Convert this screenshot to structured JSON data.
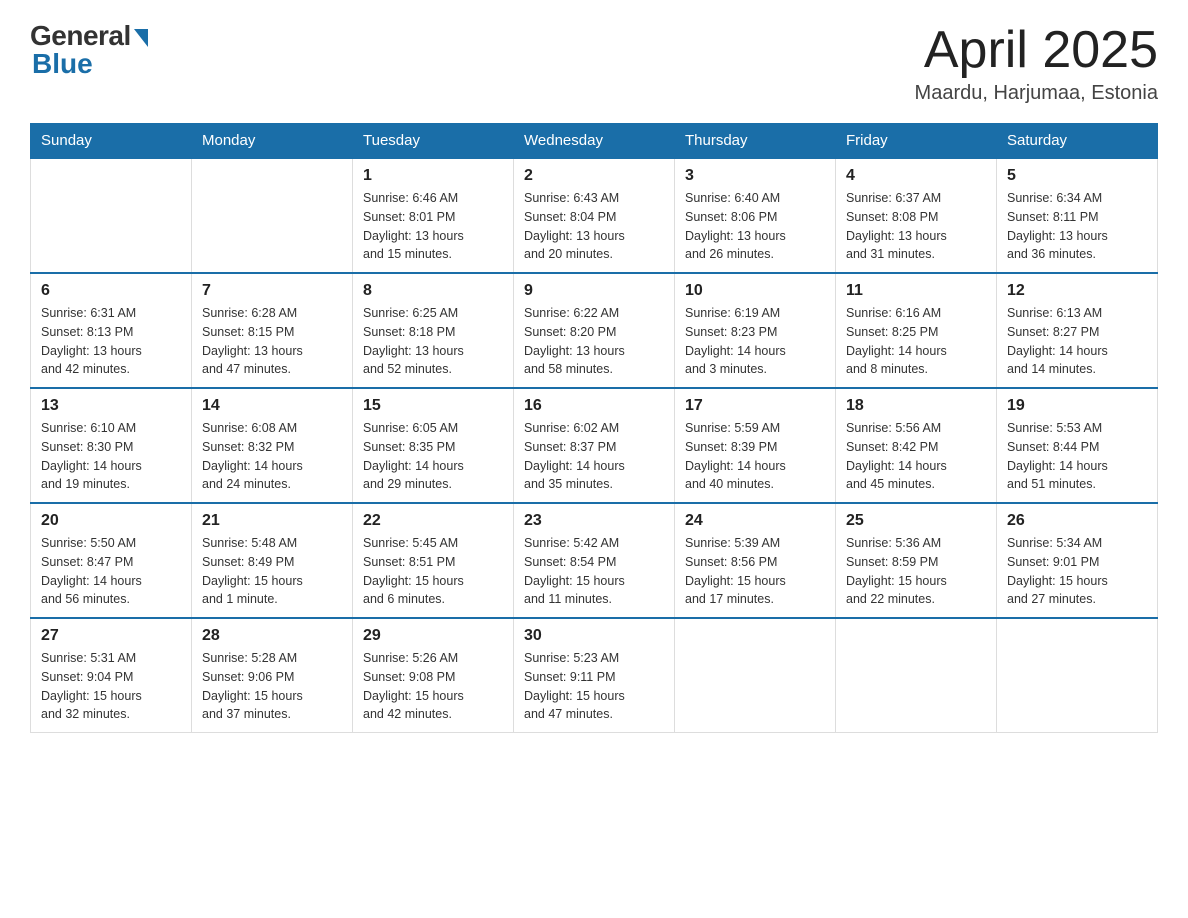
{
  "header": {
    "logo_general": "General",
    "logo_blue": "Blue",
    "month_title": "April 2025",
    "location": "Maardu, Harjumaa, Estonia"
  },
  "days_of_week": [
    "Sunday",
    "Monday",
    "Tuesday",
    "Wednesday",
    "Thursday",
    "Friday",
    "Saturday"
  ],
  "weeks": [
    [
      {
        "day": "",
        "info": ""
      },
      {
        "day": "",
        "info": ""
      },
      {
        "day": "1",
        "info": "Sunrise: 6:46 AM\nSunset: 8:01 PM\nDaylight: 13 hours\nand 15 minutes."
      },
      {
        "day": "2",
        "info": "Sunrise: 6:43 AM\nSunset: 8:04 PM\nDaylight: 13 hours\nand 20 minutes."
      },
      {
        "day": "3",
        "info": "Sunrise: 6:40 AM\nSunset: 8:06 PM\nDaylight: 13 hours\nand 26 minutes."
      },
      {
        "day": "4",
        "info": "Sunrise: 6:37 AM\nSunset: 8:08 PM\nDaylight: 13 hours\nand 31 minutes."
      },
      {
        "day": "5",
        "info": "Sunrise: 6:34 AM\nSunset: 8:11 PM\nDaylight: 13 hours\nand 36 minutes."
      }
    ],
    [
      {
        "day": "6",
        "info": "Sunrise: 6:31 AM\nSunset: 8:13 PM\nDaylight: 13 hours\nand 42 minutes."
      },
      {
        "day": "7",
        "info": "Sunrise: 6:28 AM\nSunset: 8:15 PM\nDaylight: 13 hours\nand 47 minutes."
      },
      {
        "day": "8",
        "info": "Sunrise: 6:25 AM\nSunset: 8:18 PM\nDaylight: 13 hours\nand 52 minutes."
      },
      {
        "day": "9",
        "info": "Sunrise: 6:22 AM\nSunset: 8:20 PM\nDaylight: 13 hours\nand 58 minutes."
      },
      {
        "day": "10",
        "info": "Sunrise: 6:19 AM\nSunset: 8:23 PM\nDaylight: 14 hours\nand 3 minutes."
      },
      {
        "day": "11",
        "info": "Sunrise: 6:16 AM\nSunset: 8:25 PM\nDaylight: 14 hours\nand 8 minutes."
      },
      {
        "day": "12",
        "info": "Sunrise: 6:13 AM\nSunset: 8:27 PM\nDaylight: 14 hours\nand 14 minutes."
      }
    ],
    [
      {
        "day": "13",
        "info": "Sunrise: 6:10 AM\nSunset: 8:30 PM\nDaylight: 14 hours\nand 19 minutes."
      },
      {
        "day": "14",
        "info": "Sunrise: 6:08 AM\nSunset: 8:32 PM\nDaylight: 14 hours\nand 24 minutes."
      },
      {
        "day": "15",
        "info": "Sunrise: 6:05 AM\nSunset: 8:35 PM\nDaylight: 14 hours\nand 29 minutes."
      },
      {
        "day": "16",
        "info": "Sunrise: 6:02 AM\nSunset: 8:37 PM\nDaylight: 14 hours\nand 35 minutes."
      },
      {
        "day": "17",
        "info": "Sunrise: 5:59 AM\nSunset: 8:39 PM\nDaylight: 14 hours\nand 40 minutes."
      },
      {
        "day": "18",
        "info": "Sunrise: 5:56 AM\nSunset: 8:42 PM\nDaylight: 14 hours\nand 45 minutes."
      },
      {
        "day": "19",
        "info": "Sunrise: 5:53 AM\nSunset: 8:44 PM\nDaylight: 14 hours\nand 51 minutes."
      }
    ],
    [
      {
        "day": "20",
        "info": "Sunrise: 5:50 AM\nSunset: 8:47 PM\nDaylight: 14 hours\nand 56 minutes."
      },
      {
        "day": "21",
        "info": "Sunrise: 5:48 AM\nSunset: 8:49 PM\nDaylight: 15 hours\nand 1 minute."
      },
      {
        "day": "22",
        "info": "Sunrise: 5:45 AM\nSunset: 8:51 PM\nDaylight: 15 hours\nand 6 minutes."
      },
      {
        "day": "23",
        "info": "Sunrise: 5:42 AM\nSunset: 8:54 PM\nDaylight: 15 hours\nand 11 minutes."
      },
      {
        "day": "24",
        "info": "Sunrise: 5:39 AM\nSunset: 8:56 PM\nDaylight: 15 hours\nand 17 minutes."
      },
      {
        "day": "25",
        "info": "Sunrise: 5:36 AM\nSunset: 8:59 PM\nDaylight: 15 hours\nand 22 minutes."
      },
      {
        "day": "26",
        "info": "Sunrise: 5:34 AM\nSunset: 9:01 PM\nDaylight: 15 hours\nand 27 minutes."
      }
    ],
    [
      {
        "day": "27",
        "info": "Sunrise: 5:31 AM\nSunset: 9:04 PM\nDaylight: 15 hours\nand 32 minutes."
      },
      {
        "day": "28",
        "info": "Sunrise: 5:28 AM\nSunset: 9:06 PM\nDaylight: 15 hours\nand 37 minutes."
      },
      {
        "day": "29",
        "info": "Sunrise: 5:26 AM\nSunset: 9:08 PM\nDaylight: 15 hours\nand 42 minutes."
      },
      {
        "day": "30",
        "info": "Sunrise: 5:23 AM\nSunset: 9:11 PM\nDaylight: 15 hours\nand 47 minutes."
      },
      {
        "day": "",
        "info": ""
      },
      {
        "day": "",
        "info": ""
      },
      {
        "day": "",
        "info": ""
      }
    ]
  ]
}
